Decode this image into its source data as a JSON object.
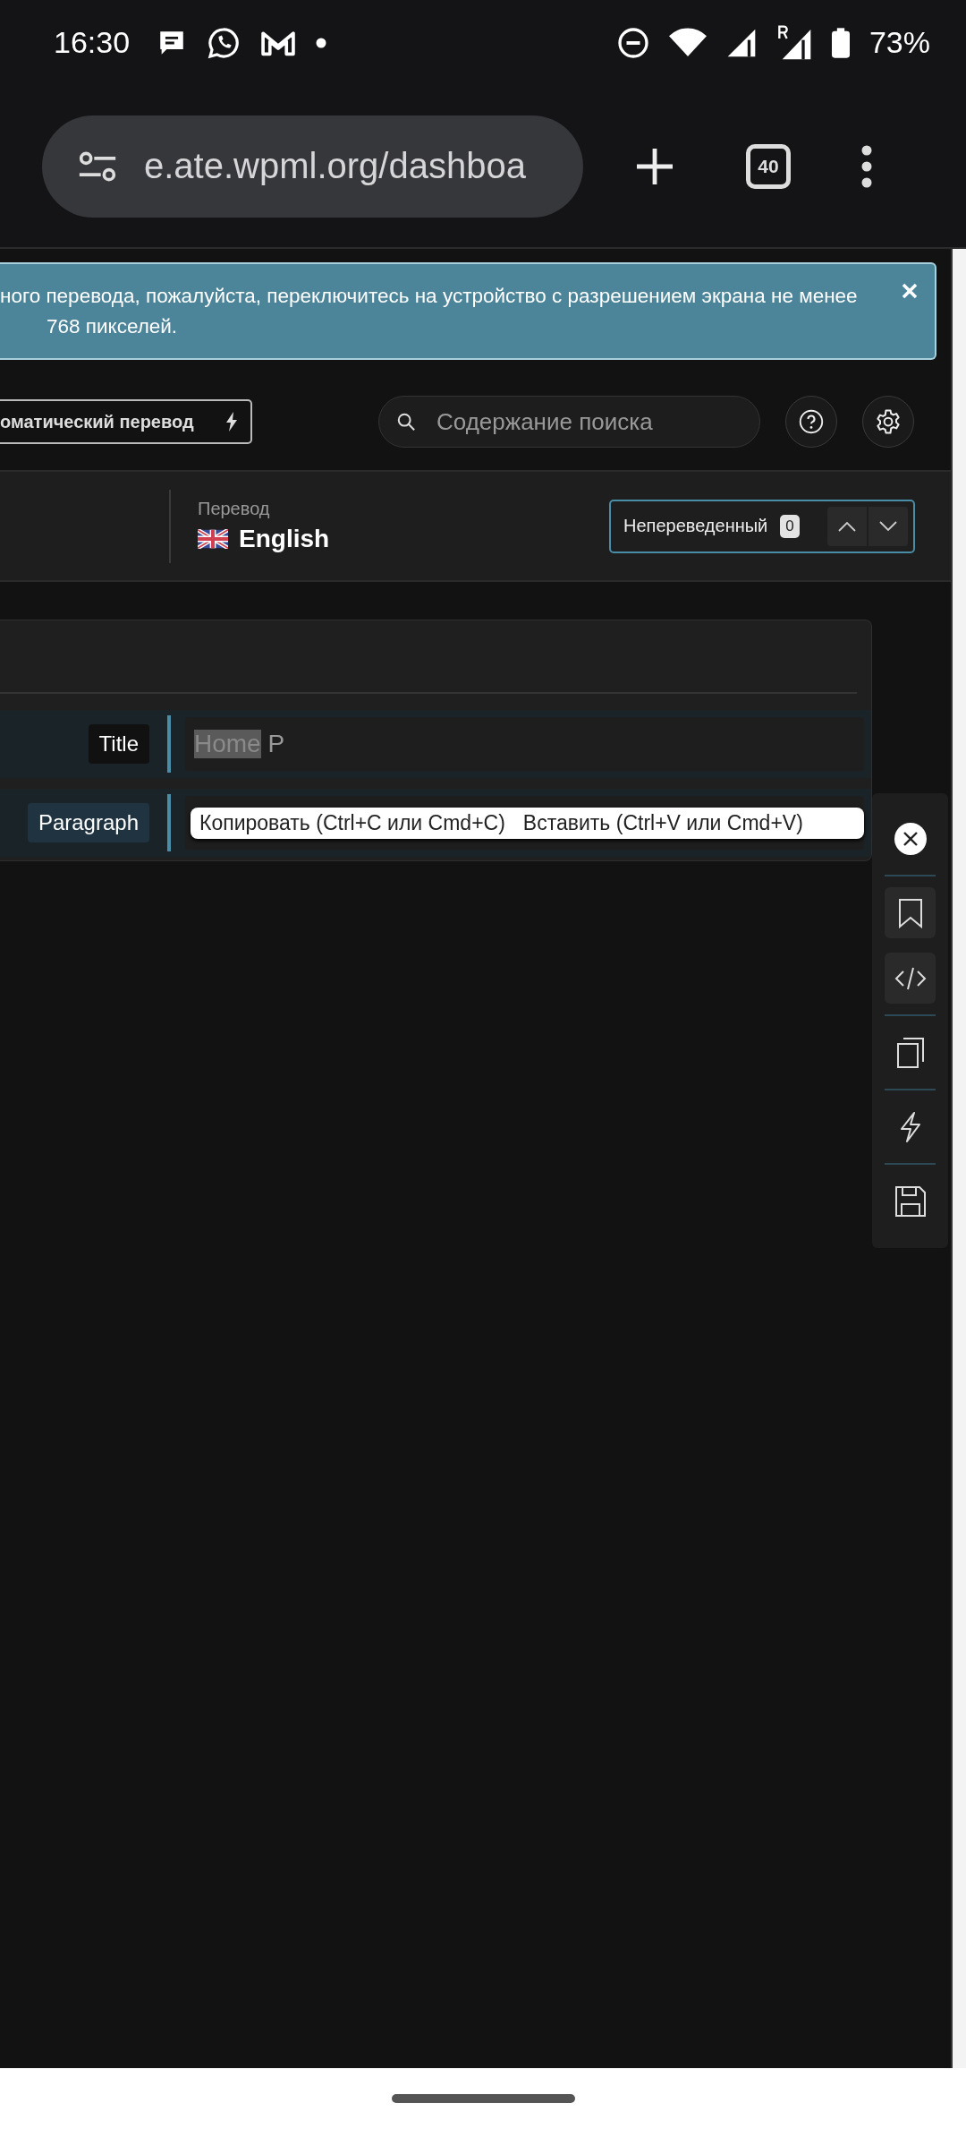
{
  "status_bar": {
    "time": "16:30",
    "battery": "73%"
  },
  "browser": {
    "url": "e.ate.wpml.org/dashboa",
    "tab_count": "40"
  },
  "banner": {
    "text": "ного перевода, пожалуйста, переключитесь на устройство с разрешением экрана не менее 768 пикселей."
  },
  "toolbar": {
    "auto_translate_button": "оматический перевод",
    "search": {
      "placeholder": "Содержание поиска"
    }
  },
  "header": {
    "language_label": "Перевод",
    "language": "English",
    "filter": {
      "label": "Непереведенный",
      "count": "0"
    }
  },
  "rows": [
    {
      "label": "Title",
      "focused": false,
      "text_parts": [
        {
          "text": "Home",
          "selected": true
        },
        {
          "text": " P",
          "selected": false
        }
      ]
    },
    {
      "label": "Paragraph",
      "focused": true,
      "context_menu": [
        "Копировать (Ctrl+C или Cmd+C)",
        "Вставить (Ctrl+V или Cmd+V)"
      ]
    }
  ]
}
